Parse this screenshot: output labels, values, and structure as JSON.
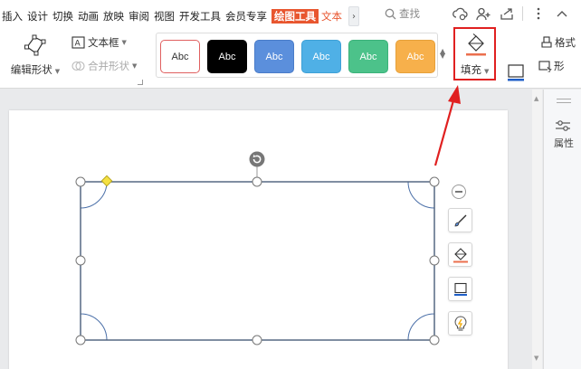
{
  "menu": {
    "items": [
      "插入",
      "设计",
      "切换",
      "动画",
      "放映",
      "审阅",
      "视图",
      "开发工具",
      "会员专享"
    ],
    "active_tab": "绘图工具",
    "accent_tab": "文本",
    "more": "›"
  },
  "search": {
    "label": "查找"
  },
  "ribbon": {
    "edit_shape": "编辑形状",
    "text_box": "文本框",
    "merge_shape": "合并形状",
    "styles": [
      {
        "label": "Abc",
        "bg": "#ffffff",
        "fg": "#333333",
        "border": "#e06060"
      },
      {
        "label": "Abc",
        "bg": "#000000",
        "fg": "#ffffff",
        "border": "#000000"
      },
      {
        "label": "Abc",
        "bg": "#5b8fdc",
        "fg": "#ffffff",
        "border": "#4a7cc8"
      },
      {
        "label": "Abc",
        "bg": "#4fb0e6",
        "fg": "#ffffff",
        "border": "#3ea0d6"
      },
      {
        "label": "Abc",
        "bg": "#4cc28a",
        "fg": "#ffffff",
        "border": "#3bb27a"
      },
      {
        "label": "Abc",
        "bg": "#f7b04b",
        "fg": "#ffffff",
        "border": "#e6a03a"
      }
    ],
    "fill": "填充",
    "outline": "轮廓",
    "format_painter": "格式",
    "shape_effect": "形"
  },
  "right_panel": {
    "properties": "属性"
  },
  "colors": {
    "accent": "#e8562f",
    "highlight": "#e02020",
    "shape_stroke": "#4a5e7a",
    "yellow_handle": "#f5e142"
  }
}
